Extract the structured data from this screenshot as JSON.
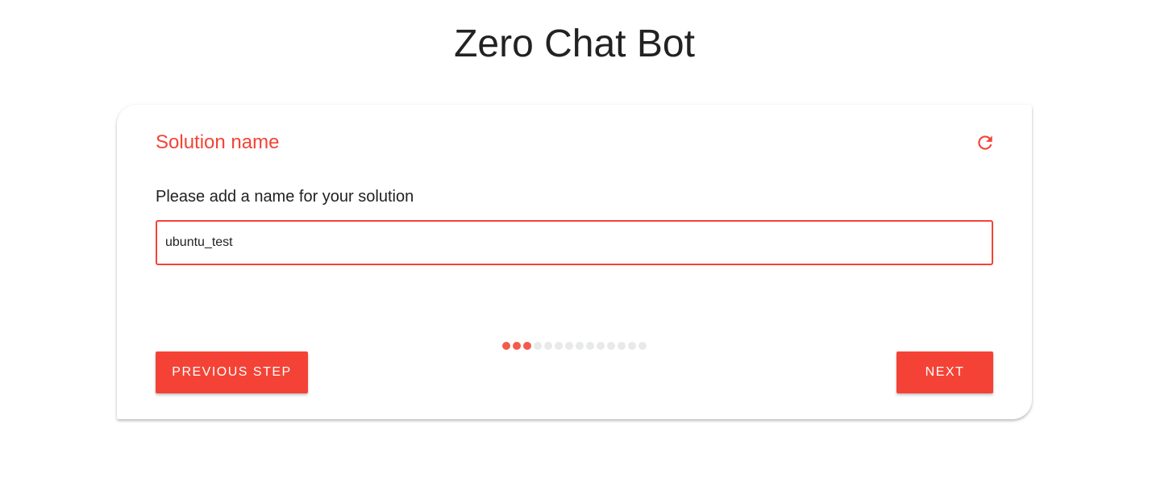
{
  "app": {
    "title": "Zero Chat Bot"
  },
  "card": {
    "title": "Solution name",
    "prompt": "Please add a name for your solution",
    "input_value": "ubuntu_test",
    "refresh_icon": "refresh-icon"
  },
  "progress": {
    "total_steps": 14,
    "current_step": 3,
    "active_color": "#f45a4e"
  },
  "buttons": {
    "previous": "PREVIOUS STEP",
    "next": "NEXT"
  },
  "colors": {
    "accent": "#f44336"
  }
}
